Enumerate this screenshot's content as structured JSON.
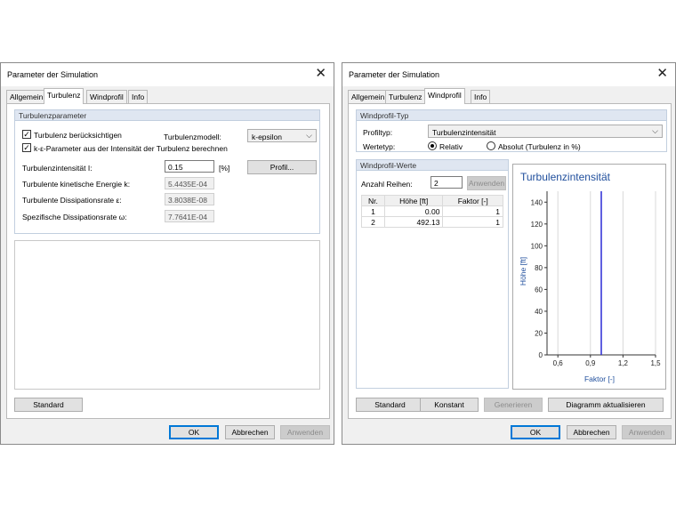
{
  "dialog_left": {
    "title": "Parameter der Simulation",
    "tabs": [
      "Allgemein",
      "Turbulenz",
      "Windprofil",
      "Info"
    ],
    "active_tab": "Turbulenz",
    "group_title": "Turbulenzparameter",
    "cb_turbulence": {
      "label": "Turbulenz berücksichtigen",
      "checked": true
    },
    "model_label": "Turbulenzmodell:",
    "model_value": "k-epsilon",
    "cb_keps": {
      "label": "k-ε-Parameter aus der Intensität der Turbulenz berechnen",
      "checked": true
    },
    "intensity_label": "Turbulenzintensität I:",
    "intensity_value": "0.15",
    "intensity_unit": "[%]",
    "profile_button": "Profil...",
    "kinetic_label": "Turbulente kinetische Energie k:",
    "kinetic_value": "5.4435E-04",
    "dissipation_label": "Turbulente Dissipationsrate ε:",
    "dissipation_value": "3.8038E-08",
    "specific_label": "Spezifische Dissipationsrate ω:",
    "specific_value": "7.7641E-04",
    "standard_button": "Standard",
    "ok": "OK",
    "cancel": "Abbrechen",
    "apply": "Anwenden"
  },
  "dialog_right": {
    "title": "Parameter der Simulation",
    "tabs": [
      "Allgemein",
      "Turbulenz",
      "Windprofil",
      "Info"
    ],
    "active_tab": "Windprofil",
    "type_group_title": "Windprofil-Typ",
    "profile_type_label": "Profiltyp:",
    "profile_type_value": "Turbulenzintensität",
    "value_type_label": "Wertetyp:",
    "radio_relative": {
      "label": "Relativ",
      "selected": true
    },
    "radio_absolute": {
      "label": "Absolut (Turbulenz in %)",
      "selected": false
    },
    "values_group_title": "Windprofil-Werte",
    "rows_label": "Anzahl Reihen:",
    "rows_value": "2",
    "apply_rows_button": "Anwenden",
    "table": {
      "headers": [
        "Nr.",
        "Höhe [ft]",
        "Faktor [-]"
      ],
      "rows": [
        [
          "1",
          "0.00",
          "1"
        ],
        [
          "2",
          "492.13",
          "1"
        ]
      ]
    },
    "standard_button": "Standard",
    "constant_button": "Konstant",
    "generate_button": "Generieren",
    "update_chart_button": "Diagramm aktualisieren",
    "ok": "OK",
    "cancel": "Abbrechen",
    "apply": "Anwenden"
  },
  "colors": {
    "accent": "#0078d7",
    "chart_title": "#1f4e9c",
    "series": "#2a2ad6"
  },
  "chart_data": {
    "type": "line",
    "title": "Turbulenzintensität",
    "xlabel": "Faktor [-]",
    "ylabel": "Höhe [ft]",
    "xlim": [
      0.5,
      1.5
    ],
    "ylim": [
      0,
      150
    ],
    "x_ticks": [
      "0,6",
      "0,9",
      "1,2",
      "1,5"
    ],
    "x_tick_values": [
      0.6,
      0.9,
      1.2,
      1.5
    ],
    "y_ticks": [
      "0",
      "20",
      "40",
      "60",
      "80",
      "100",
      "120",
      "140"
    ],
    "y_tick_values": [
      0,
      20,
      40,
      60,
      80,
      100,
      120,
      140
    ],
    "series": [
      {
        "x": [
          1,
          1
        ],
        "y": [
          0,
          150
        ]
      }
    ],
    "grid": true
  }
}
